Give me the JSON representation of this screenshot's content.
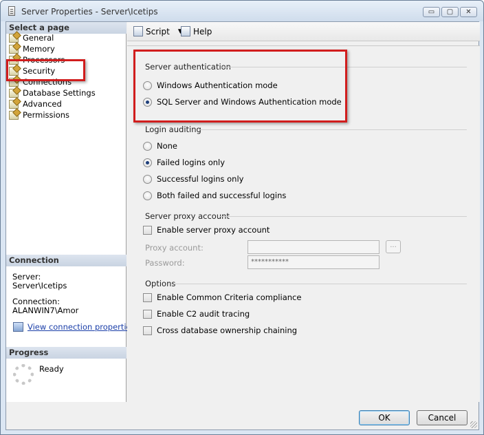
{
  "window": {
    "title": "Server Properties - Server\\Icetips",
    "controls": {
      "minimize": "▭",
      "maximize": "▢",
      "close": "✕"
    }
  },
  "left_pane": {
    "select_page_header": "Select a page",
    "pages": [
      "General",
      "Memory",
      "Processors",
      "Security",
      "Connections",
      "Database Settings",
      "Advanced",
      "Permissions"
    ],
    "connection_header": "Connection",
    "server_label": "Server:",
    "server_value": "Server\\Icetips",
    "connection_label": "Connection:",
    "connection_value": "ALANWIN7\\Amor",
    "view_link": "View connection properties",
    "progress_header": "Progress",
    "progress_status": "Ready"
  },
  "toolbar": {
    "script": "Script",
    "help": "Help"
  },
  "security": {
    "server_auth": {
      "label": "Server authentication",
      "options": [
        "Windows Authentication mode",
        "SQL Server and Windows Authentication mode"
      ],
      "selected": 1
    },
    "login_auditing": {
      "label": "Login auditing",
      "options": [
        "None",
        "Failed logins only",
        "Successful logins only",
        "Both failed and successful logins"
      ],
      "selected": 1
    },
    "proxy": {
      "label": "Server proxy account",
      "enable_label": "Enable server proxy account",
      "account_label": "Proxy account:",
      "account_value": "",
      "browse_label": "...",
      "password_label": "Password:",
      "password_value": "***********"
    },
    "options": {
      "label": "Options",
      "items": [
        "Enable Common Criteria compliance",
        "Enable C2 audit tracing",
        "Cross database ownership chaining"
      ]
    }
  },
  "buttons": {
    "ok": "OK",
    "cancel": "Cancel"
  },
  "colors": {
    "highlight": "#d11d1d",
    "link": "#1a3ea8"
  }
}
